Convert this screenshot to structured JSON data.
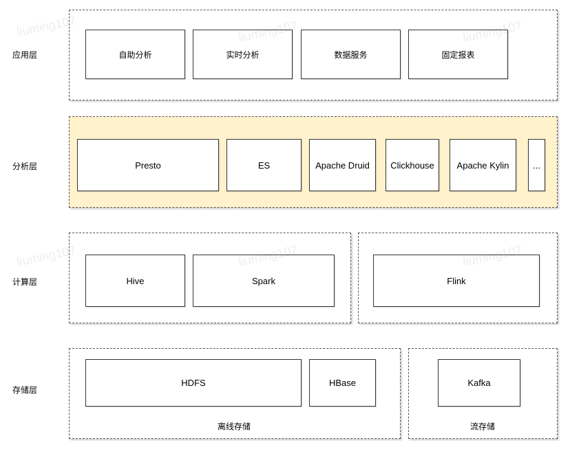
{
  "watermark": "liuming107",
  "colors": {
    "analysis_layer_fill": "#fff2cc",
    "border": "#333333"
  },
  "layers": {
    "application": {
      "label": "应用层",
      "items": [
        "自助分析",
        "实时分析",
        "数据服务",
        "固定报表"
      ]
    },
    "analysis": {
      "label": "分析层",
      "items": [
        "Presto",
        "ES",
        "Apache Druid",
        "Clickhouse",
        "Apache Kylin",
        "..."
      ]
    },
    "compute": {
      "label": "计算层",
      "batch_items": [
        "Hive",
        "Spark"
      ],
      "stream_items": [
        "Flink"
      ]
    },
    "storage": {
      "label": "存储层",
      "offline_items": [
        "HDFS",
        "HBase"
      ],
      "offline_caption": "离线存储",
      "stream_items": [
        "Kafka"
      ],
      "stream_caption": "流存储"
    }
  }
}
